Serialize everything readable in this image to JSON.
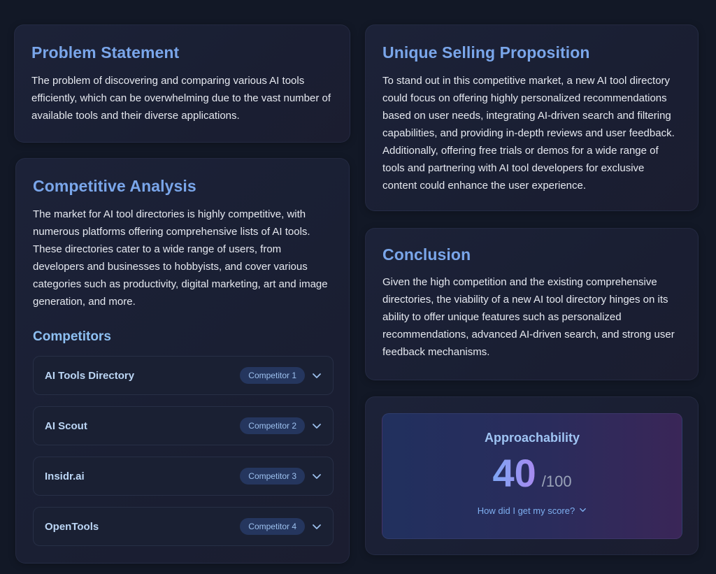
{
  "problem": {
    "title": "Problem Statement",
    "body": "The problem of discovering and comparing various AI tools efficiently, which can be overwhelming due to the vast number of available tools and their diverse applications."
  },
  "competitive": {
    "title": "Competitive Analysis",
    "body": "The market for AI tool directories is highly competitive, with numerous platforms offering comprehensive lists of AI tools. These directories cater to a wide range of users, from developers and businesses to hobbyists, and cover various categories such as productivity, digital marketing, art and image generation, and more.",
    "competitors_heading": "Competitors",
    "competitors": [
      {
        "name": "AI Tools Directory",
        "badge": "Competitor 1",
        "icon": "chevron-down-icon"
      },
      {
        "name": "AI Scout",
        "badge": "Competitor 2",
        "icon": "chevron-down-icon"
      },
      {
        "name": "Insidr.ai",
        "badge": "Competitor 3",
        "icon": "chevron-down-icon"
      },
      {
        "name": "OpenTools",
        "badge": "Competitor 4",
        "icon": "chevron-down-icon"
      }
    ]
  },
  "usp": {
    "title": "Unique Selling Proposition",
    "body": "To stand out in this competitive market, a new AI tool directory could focus on offering highly personalized recommendations based on user needs, integrating AI-driven search and filtering capabilities, and providing in-depth reviews and user feedback. Additionally, offering free trials or demos for a wide range of tools and partnering with AI tool developers for exclusive content could enhance the user experience."
  },
  "conclusion": {
    "title": "Conclusion",
    "body": "Given the high competition and the existing comprehensive directories, the viability of a new AI tool directory hinges on its ability to offer unique features such as personalized recommendations, advanced AI-driven search, and strong user feedback mechanisms."
  },
  "approachability": {
    "title": "Approachability",
    "score": "40",
    "max": "/100",
    "link_label": "How did I get my score?",
    "link_icon": "chevron-down-icon"
  },
  "colors": {
    "background": "#121826",
    "heading": "#7aa6ea",
    "competitor_name": "#bcd6f5",
    "badge_bg": "#25365e"
  }
}
